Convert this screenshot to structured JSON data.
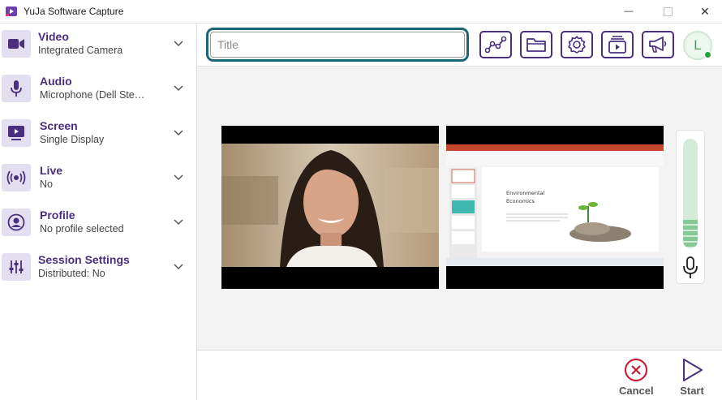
{
  "window": {
    "title": "YuJa Software Capture",
    "minimize_glyph": "—",
    "close_glyph": "✕"
  },
  "sidebar": {
    "items": [
      {
        "title": "Video",
        "subtitle": "Integrated Camera",
        "icon": "video-camera-icon"
      },
      {
        "title": "Audio",
        "subtitle": "Microphone (Dell Ste…",
        "icon": "microphone-icon"
      },
      {
        "title": "Screen",
        "subtitle": "Single Display",
        "icon": "screen-play-icon"
      },
      {
        "title": "Live",
        "subtitle": "No",
        "icon": "broadcast-icon"
      },
      {
        "title": "Profile",
        "subtitle": "No profile selected",
        "icon": "profile-icon"
      },
      {
        "title": "Session Settings",
        "subtitle": "Distributed: No",
        "icon": "sliders-icon"
      }
    ]
  },
  "toolbar": {
    "title_placeholder": "Title",
    "title_value": "",
    "buttons": [
      "analytics-icon",
      "folder-icon",
      "gear-icon",
      "media-library-icon",
      "announcement-icon"
    ],
    "avatar_letter": "L",
    "avatar_status": "online"
  },
  "slides": {
    "heading_line1": "Environmental",
    "heading_line2": "Economics"
  },
  "audio_meter": {
    "level": 0.27
  },
  "footer": {
    "cancel_label": "Cancel",
    "start_label": "Start"
  },
  "colors": {
    "accent_purple": "#4a2f7e",
    "title_border": "#1b6577",
    "cancel_red": "#c8102e",
    "meter_green": "#86c995"
  }
}
